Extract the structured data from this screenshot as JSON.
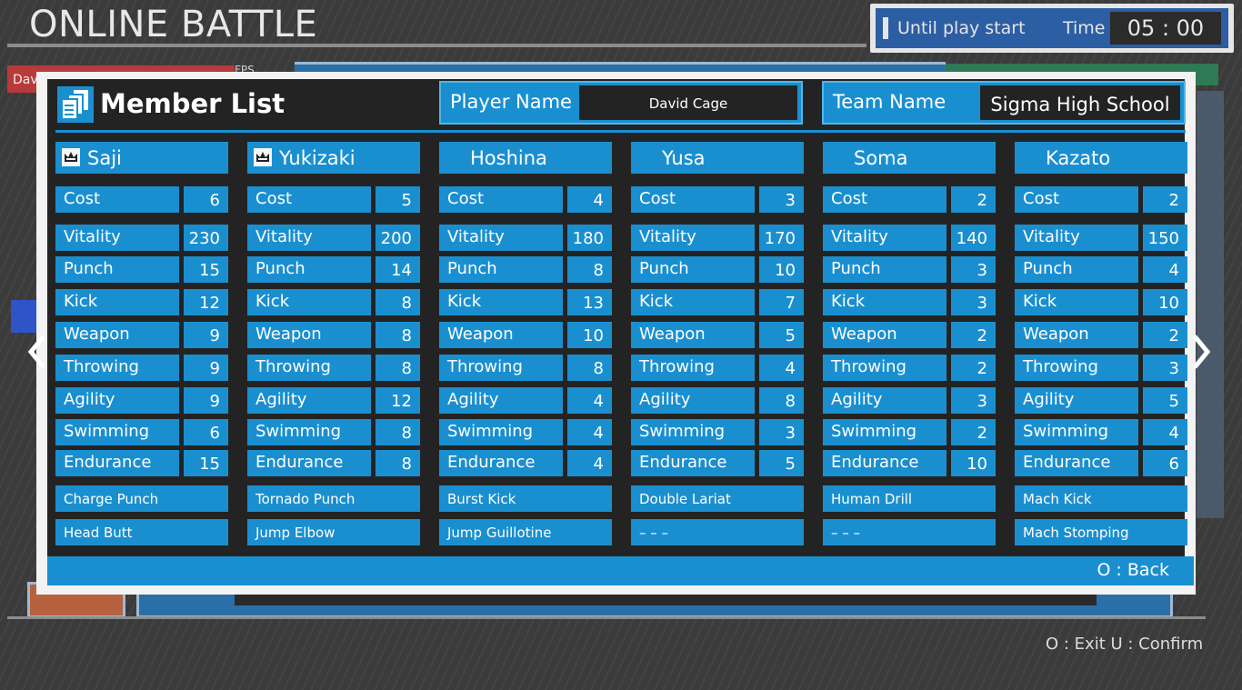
{
  "header": {
    "title": "ONLINE BATTLE",
    "until_label": "Until play start",
    "time_label": "Time",
    "time_value": "05 : 00"
  },
  "background": {
    "red_label": "Davi",
    "fps_label": "FPS"
  },
  "modal": {
    "title": "Member List",
    "player_label": "Player Name",
    "player_value": "David Cage",
    "team_label": "Team Name",
    "team_value": "Sigma High School",
    "back_hint": "O : Back"
  },
  "stat_labels": [
    "Cost",
    "Vitality",
    "Punch",
    "Kick",
    "Weapon",
    "Throwing",
    "Agility",
    "Swimming",
    "Endurance"
  ],
  "members": [
    {
      "name": "Saji",
      "leader": true,
      "stats": [
        6,
        230,
        15,
        12,
        9,
        9,
        9,
        6,
        15
      ],
      "skills": [
        "Charge Punch",
        "Head Butt"
      ]
    },
    {
      "name": "Yukizaki",
      "leader": true,
      "stats": [
        5,
        200,
        14,
        8,
        8,
        8,
        12,
        8,
        8
      ],
      "skills": [
        "Tornado Punch",
        "Jump Elbow"
      ]
    },
    {
      "name": "Hoshina",
      "leader": false,
      "stats": [
        4,
        180,
        8,
        13,
        10,
        8,
        4,
        4,
        4
      ],
      "skills": [
        "Burst Kick",
        "Jump Guillotine"
      ]
    },
    {
      "name": "Yusa",
      "leader": false,
      "stats": [
        3,
        170,
        10,
        7,
        5,
        4,
        8,
        3,
        5
      ],
      "skills": [
        "Double Lariat",
        "– – –"
      ]
    },
    {
      "name": "Soma",
      "leader": false,
      "stats": [
        2,
        140,
        3,
        3,
        2,
        2,
        3,
        2,
        10
      ],
      "skills": [
        "Human Drill",
        "– – –"
      ]
    },
    {
      "name": "Kazato",
      "leader": false,
      "stats": [
        2,
        150,
        4,
        10,
        2,
        3,
        5,
        4,
        6
      ],
      "skills": [
        "Mach Kick",
        "Mach Stomping"
      ]
    }
  ],
  "footer": {
    "hint": "O : Exit  U : Confirm"
  },
  "colors": {
    "accent": "#1a8fd0",
    "panel": "#232323",
    "frame": "#f3f3f3"
  }
}
